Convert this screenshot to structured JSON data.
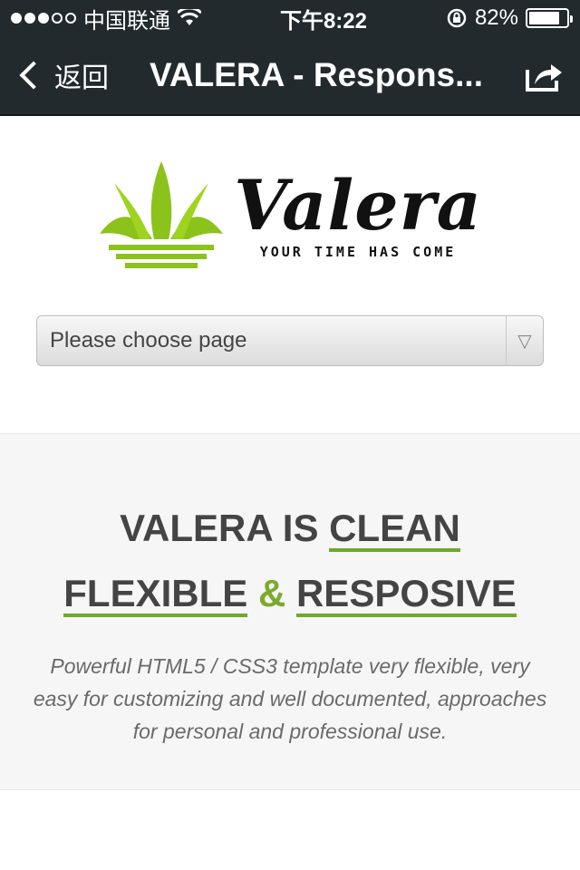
{
  "status_bar": {
    "carrier": "中国联通",
    "time": "下午8:22",
    "battery": "82%",
    "battery_level": 0.82,
    "icons": [
      "signal-dots",
      "wifi-icon",
      "rotation-lock-icon",
      "battery-icon"
    ]
  },
  "nav": {
    "back_label": "返回",
    "title": "VALERA - Respons...",
    "share_icon": "share-icon"
  },
  "logo": {
    "brand": "Valera",
    "tagline": "YOUR TIME HAS COME",
    "leaf_color": "#8cc21c"
  },
  "select": {
    "value": "Please choose page"
  },
  "hero": {
    "line1_prefix": "VALERA IS",
    "line1_highlight": "CLEAN",
    "line2_word1": "FLEXIBLE",
    "line2_amp": "&",
    "line2_word2": "RESPOSIVE",
    "description": "Powerful HTML5 / CSS3 template very flexible, very easy for customizing and well documented, approaches for personal and professional use.",
    "accent_color": "#6fa82b"
  }
}
